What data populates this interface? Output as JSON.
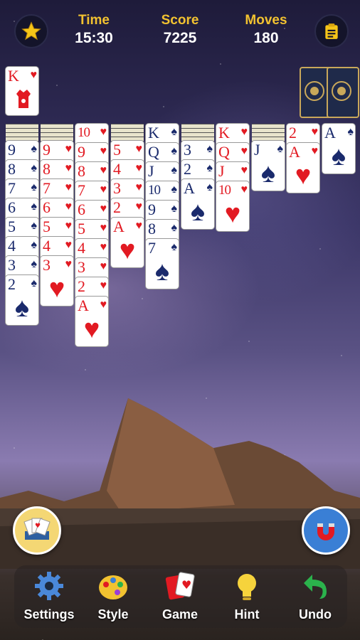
{
  "header": {
    "time_label": "Time",
    "time_value": "15:30",
    "score_label": "Score",
    "score_value": "7225",
    "moves_label": "Moves",
    "moves_value": "180"
  },
  "foundation": {
    "top_card_rank": "K",
    "top_card_suit": "♥"
  },
  "columns": [
    {
      "down": 4,
      "cards": [
        [
          "9",
          "♠",
          "blk"
        ],
        [
          "8",
          "♠",
          "blk"
        ],
        [
          "7",
          "♠",
          "blk"
        ],
        [
          "6",
          "♠",
          "blk"
        ],
        [
          "5",
          "♠",
          "blk"
        ],
        [
          "4",
          "♠",
          "blk"
        ],
        [
          "3",
          "♠",
          "blk"
        ],
        [
          "2",
          "♠",
          "blk"
        ]
      ]
    },
    {
      "down": 4,
      "cards": [
        [
          "9",
          "♥",
          "red"
        ],
        [
          "8",
          "♥",
          "red"
        ],
        [
          "7",
          "♥",
          "red"
        ],
        [
          "6",
          "♥",
          "red"
        ],
        [
          "5",
          "♥",
          "red"
        ],
        [
          "4",
          "♥",
          "red"
        ],
        [
          "3",
          "♥",
          "red"
        ]
      ]
    },
    {
      "down": 0,
      "cards": [
        [
          "10",
          "♥",
          "red"
        ],
        [
          "9",
          "♥",
          "red"
        ],
        [
          "8",
          "♥",
          "red"
        ],
        [
          "7",
          "♥",
          "red"
        ],
        [
          "6",
          "♥",
          "red"
        ],
        [
          "5",
          "♥",
          "red"
        ],
        [
          "4",
          "♥",
          "red"
        ],
        [
          "3",
          "♥",
          "red"
        ],
        [
          "2",
          "♥",
          "red"
        ],
        [
          "A",
          "♥",
          "red"
        ]
      ]
    },
    {
      "down": 4,
      "cards": [
        [
          "5",
          "♥",
          "red"
        ],
        [
          "4",
          "♥",
          "red"
        ],
        [
          "3",
          "♥",
          "red"
        ],
        [
          "2",
          "♥",
          "red"
        ],
        [
          "A",
          "♥",
          "red"
        ]
      ]
    },
    {
      "down": 0,
      "cards": [
        [
          "K",
          "♠",
          "blk"
        ],
        [
          "Q",
          "♠",
          "blk"
        ],
        [
          "J",
          "♠",
          "blk"
        ],
        [
          "10",
          "♠",
          "blk"
        ],
        [
          "9",
          "♠",
          "blk"
        ],
        [
          "8",
          "♠",
          "blk"
        ],
        [
          "7",
          "♠",
          "blk"
        ]
      ]
    },
    {
      "down": 4,
      "cards": [
        [
          "3",
          "♠",
          "blk"
        ],
        [
          "2",
          "♠",
          "blk"
        ],
        [
          "A",
          "♠",
          "blk"
        ]
      ]
    },
    {
      "down": 0,
      "cards": [
        [
          "K",
          "♥",
          "red"
        ],
        [
          "Q",
          "♥",
          "red"
        ],
        [
          "J",
          "♥",
          "red"
        ],
        [
          "10",
          "♥",
          "red"
        ]
      ]
    },
    {
      "down": 4,
      "cards": [
        [
          "J",
          "♠",
          "blk"
        ]
      ]
    },
    {
      "down": 0,
      "cards": [
        [
          "2",
          "♥",
          "red"
        ],
        [
          "A",
          "♥",
          "red"
        ]
      ]
    },
    {
      "down": 0,
      "cards": [
        [
          "A",
          "♠",
          "blk"
        ]
      ]
    }
  ],
  "nav": {
    "settings": "Settings",
    "style": "Style",
    "game": "Game",
    "hint": "Hint",
    "undo": "Undo"
  },
  "colors": {
    "accent": "#f2c230",
    "red_suit": "#e21a22",
    "black_suit": "#1a2a6c"
  }
}
